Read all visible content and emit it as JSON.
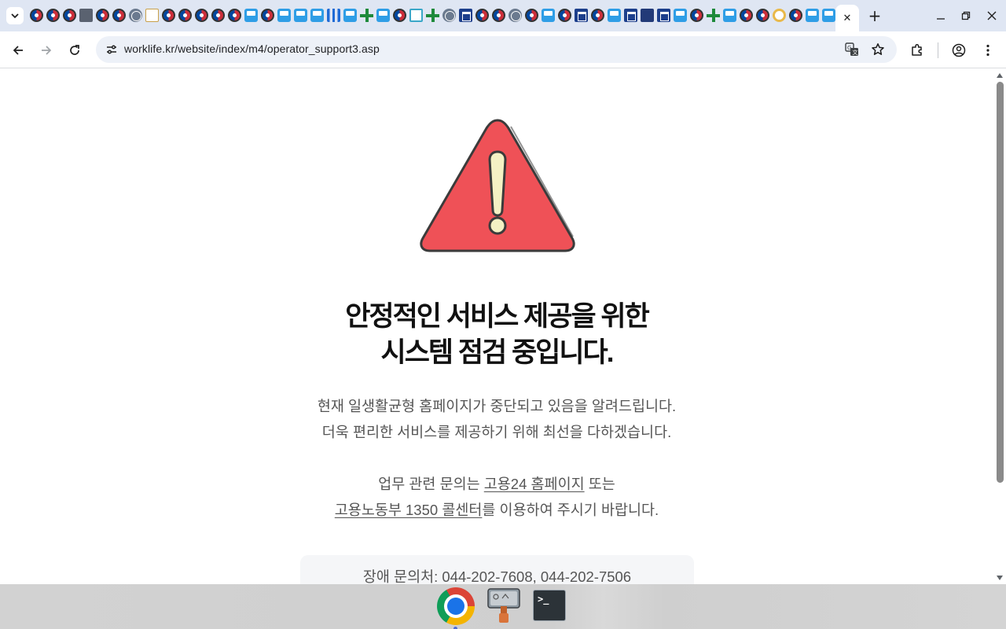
{
  "browser": {
    "url": "worklife.kr/website/index/m4/operator_support3.asp",
    "tab_close_glyph": "✕",
    "new_tab_glyph": "+",
    "favicons": [
      "gov",
      "gov",
      "gov",
      "folder",
      "gov",
      "gov",
      "globe",
      "tiny",
      "gov",
      "gov",
      "gov",
      "gov",
      "gov",
      "blue",
      "gov",
      "blue",
      "blue",
      "blue",
      "bars",
      "blue",
      "plus",
      "blue",
      "gov",
      "outline",
      "plus",
      "globe",
      "house",
      "gov",
      "gov",
      "globe",
      "gov",
      "blue",
      "gov",
      "house",
      "gov",
      "blue",
      "house",
      "navy",
      "house",
      "blue",
      "gov",
      "plus",
      "blue",
      "gov",
      "gov",
      "ring",
      "gov",
      "blue",
      "blue",
      "load"
    ]
  },
  "page": {
    "headline_line1": "안정적인 서비스 제공을 위한",
    "headline_line2": "시스템 점검 중입니다.",
    "notice_line1": "현재 일생활균형 홈페이지가 중단되고 있음을 알려드립니다.",
    "notice_line2": "더욱 편리한 서비스를 제공하기 위해 최선을 다하겠습니다.",
    "inquiry_prefix": "업무 관련 문의는 ",
    "link_goyong24": "고용24 홈페이지",
    "inquiry_or": " 또는",
    "link_callcenter": "고용노동부 1350 콜센터",
    "inquiry_suffix": "를 이용하여 주시기 바랍니다.",
    "contact_label": "장애 문의처: 044-202-7608, 044-202-7506"
  },
  "taskbar": {
    "apps": [
      "chrome-icon",
      "tool-icon",
      "terminal-icon"
    ],
    "terminal_prompt": ">_"
  },
  "colors": {
    "warning_red": "#ef5157",
    "warning_mark": "#f4f1c4",
    "outline": "#3b3b3b",
    "tabstrip": "#dfe6f3",
    "omnibox": "#edf1f8"
  }
}
